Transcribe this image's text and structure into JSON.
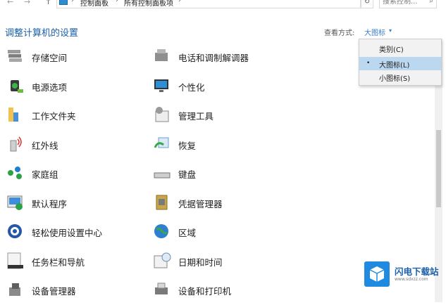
{
  "address": {
    "nav_back": "←",
    "nav_forward": "→",
    "nav_up": "↑",
    "crumbs": [
      "控制面板",
      "所有控制面板项"
    ],
    "separator": "›",
    "refresh": "↻",
    "search_placeholder": "搜索控制..."
  },
  "header": {
    "title": "调整计算机的设置",
    "view_by_label": "查看方式:",
    "view_by_value": "大图标",
    "view_by_arrow": "▾"
  },
  "items_left": [
    {
      "label": "存储空间",
      "icon": "storage-spaces-icon"
    },
    {
      "label": "电源选项",
      "icon": "power-options-icon"
    },
    {
      "label": "工作文件夹",
      "icon": "work-folders-icon"
    },
    {
      "label": "红外线",
      "icon": "infrared-icon"
    },
    {
      "label": "家庭组",
      "icon": "homegroup-icon"
    },
    {
      "label": "默认程序",
      "icon": "default-programs-icon"
    },
    {
      "label": "轻松使用设置中心",
      "icon": "ease-of-access-icon"
    },
    {
      "label": "任务栏和导航",
      "icon": "taskbar-icon"
    },
    {
      "label": "设备管理器",
      "icon": "device-manager-icon"
    }
  ],
  "items_right": [
    {
      "label": "电话和调制解调器",
      "icon": "phone-modem-icon"
    },
    {
      "label": "个性化",
      "icon": "personalization-icon"
    },
    {
      "label": "管理工具",
      "icon": "admin-tools-icon"
    },
    {
      "label": "恢复",
      "icon": "recovery-icon"
    },
    {
      "label": "键盘",
      "icon": "keyboard-icon"
    },
    {
      "label": "凭据管理器",
      "icon": "credential-manager-icon"
    },
    {
      "label": "区域",
      "icon": "region-icon"
    },
    {
      "label": "日期和时间",
      "icon": "date-time-icon"
    },
    {
      "label": "设备和打印机",
      "icon": "devices-printers-icon"
    }
  ],
  "view_menu": {
    "options": [
      "类别(C)",
      "大图标(L)",
      "小图标(S)"
    ],
    "selected_marker": "•"
  },
  "watermark": {
    "name": "闪电下载站",
    "url": "www.sdxzz.com"
  }
}
